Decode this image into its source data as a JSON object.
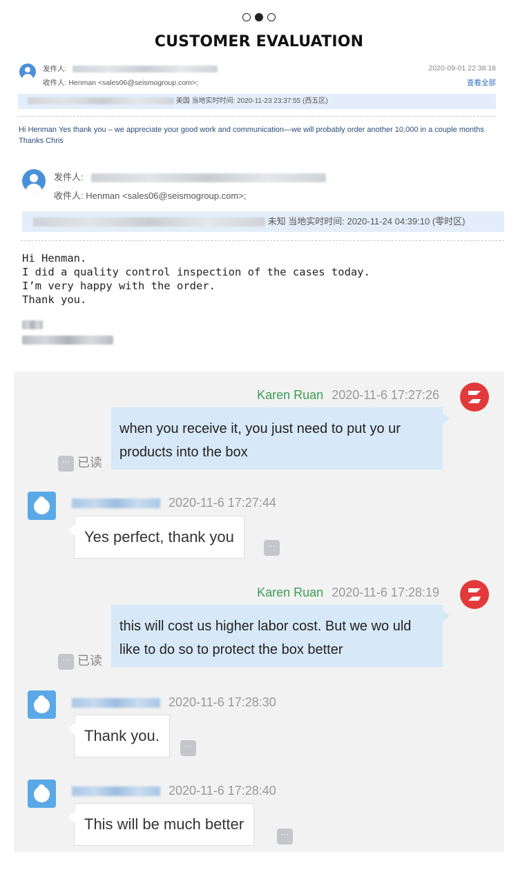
{
  "header": {
    "pager": {
      "count": 3,
      "active_index": 1
    },
    "title": "CUSTOMER EVALUATION"
  },
  "email1": {
    "from_label": "发件人:",
    "to_label": "收件人:",
    "to_value": "Henman <sales06@seismogroup.com>;",
    "date": "2020-09-01 22:38:18",
    "view_all": "查看全部",
    "bar_text": "美国 当地实时时间: 2020-11-23 23:37:55 (西五区)",
    "body": "Hi Henman Yes thank you – we appreciate your good work and communication—we will probably order another 10,000 in a couple months Thanks Chris"
  },
  "email2": {
    "from_label": "发件人:",
    "to_label": "收件人:",
    "to_value": "Henman <sales06@seismogroup.com>;",
    "bar_text": "未知 当地实时时间: 2020-11-24 04:39:10 (零时区)",
    "body": "Hi Henman.\nI did a quality control inspection of the cases today.\nI’m very happy with the order.\nThank you."
  },
  "chat": {
    "read_label": "已读",
    "more_glyph": "···",
    "messages": [
      {
        "side": "right",
        "sender": "Karen Ruan",
        "time": "2020-11-6 17:27:26",
        "text": "when you receive it, you just need to put yo ur products into the box"
      },
      {
        "side": "left",
        "time": "2020-11-6 17:27:44",
        "text": "Yes perfect, thank you"
      },
      {
        "side": "right",
        "sender": "Karen Ruan",
        "time": "2020-11-6 17:28:19",
        "text": "this will cost us higher labor cost. But we wo uld like to do so to protect the box better"
      },
      {
        "side": "left",
        "time": "2020-11-6 17:28:30",
        "text": "Thank you."
      },
      {
        "side": "left",
        "time": "2020-11-6 17:28:40",
        "text": "This will be much better"
      }
    ]
  },
  "colors": {
    "sender_green": "#3a9e52",
    "bubble_blue": "#d7e8f8",
    "link_blue": "#2d6fc0",
    "logo_red": "#e23a3a",
    "chat_bg": "#f2f2f2"
  },
  "icons": {
    "sender_avatar": "user-avatar-icon",
    "company_logo": "company-logo-icon",
    "customer_avatar": "customer-avatar-icon",
    "more": "more-options-icon"
  }
}
